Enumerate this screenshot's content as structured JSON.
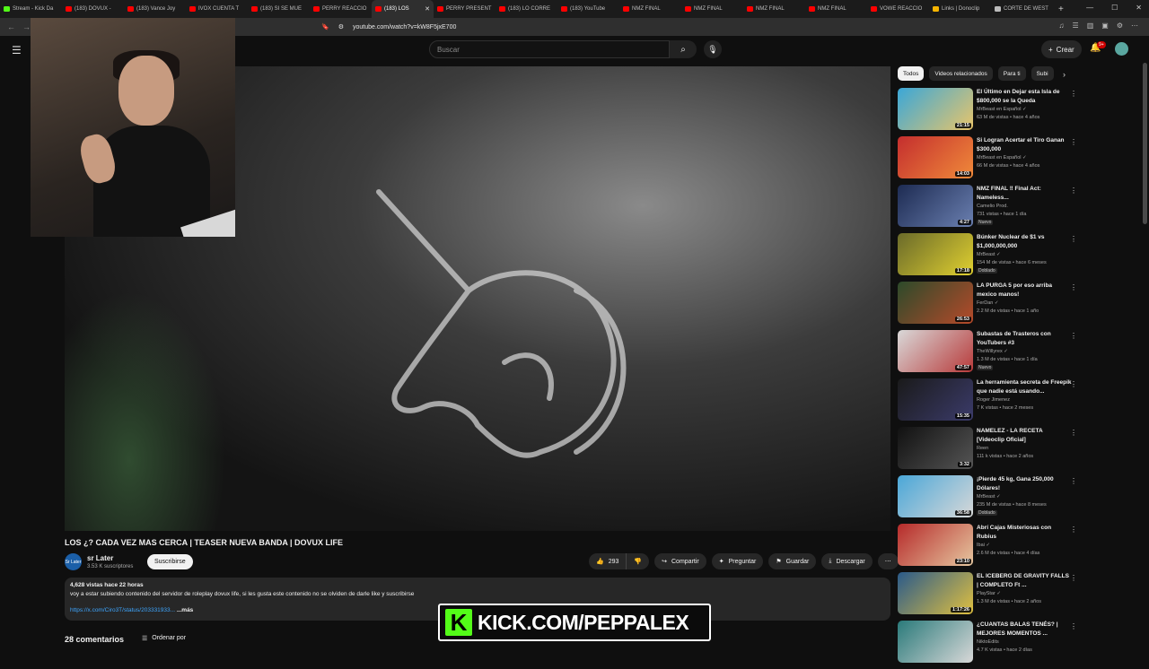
{
  "browser": {
    "tabs": [
      {
        "label": "Stream - Kick Da",
        "color": "#53fc18"
      },
      {
        "label": "(183) DOVUX -",
        "color": "#ff0000"
      },
      {
        "label": "(183) Vance Joy",
        "color": "#ff0000"
      },
      {
        "label": "IVOX CUENTA T",
        "color": "#ff0000"
      },
      {
        "label": "(183) SI SE MUE",
        "color": "#ff0000"
      },
      {
        "label": "PERRY REACCIO",
        "color": "#ff0000"
      },
      {
        "label": "(183) LOS",
        "color": "#ff0000"
      },
      {
        "label": "PERRY PRESENT",
        "color": "#ff0000"
      },
      {
        "label": "(183) LO CORRE",
        "color": "#ff0000"
      },
      {
        "label": "(183) YouTube",
        "color": "#ff0000"
      },
      {
        "label": "NMZ FINAL",
        "color": "#ff0000"
      },
      {
        "label": "NMZ FINAL",
        "color": "#ff0000"
      },
      {
        "label": "NMZ FINAL",
        "color": "#ff0000"
      },
      {
        "label": "NMZ FINAL",
        "color": "#ff0000"
      },
      {
        "label": "VOWE REACCIO",
        "color": "#ff0000"
      },
      {
        "label": "Links | Donoclip",
        "color": "#f5b400"
      },
      {
        "label": "CORTE DE WEST",
        "color": "#bbbbbb"
      }
    ],
    "new_tab": "+",
    "url": "youtube.com/watch?v=kW8F5jxE700"
  },
  "youtube": {
    "search_placeholder": "Buscar",
    "create_label": "Crear",
    "notif_count": "9+",
    "video": {
      "title": "LOS ¿? CADA VEZ MAS CERCA | TEASER NUEVA BANDA | DOVUX LIFE",
      "channel": "sr Later",
      "channel_avatar_text": "Sr Later",
      "subscribers": "3.53 K suscriptores",
      "subscribe_label": "Suscribirse",
      "likes": "293",
      "share_label": "Compartir",
      "ask_label": "Preguntar",
      "save_label": "Guardar",
      "download_label": "Descargar",
      "description_meta": "4,628 vistas  hace 22 horas",
      "description_text": "voy a estar subiendo contenido del servidor de roleplay dovux life, si les gusta este contenido no se olviden de darle like y suscribirse",
      "description_link": "https://x.com/Ciro3T/status/203331933...",
      "more_label": "...más",
      "comments_count": "28 comentarios",
      "sort_label": "Ordenar por"
    },
    "chips": [
      "Todos",
      "Videos relacionados",
      "Para ti",
      "Subi"
    ],
    "recs": [
      {
        "title": "El Último en Dejar esta Isla de $800,000 se la Queda",
        "channel": "MrBeast en Español ✓",
        "meta": "63 M de vistas • hace 4 años",
        "duration": "21:15",
        "badge": "",
        "bg": "linear-gradient(135deg,#3aa7d8,#e8c56a)"
      },
      {
        "title": "Si Logran Acertar el Tiro Ganan $300,000",
        "channel": "MrBeast en Español ✓",
        "meta": "66 M de vistas • hace 4 años",
        "duration": "14:03",
        "badge": "",
        "bg": "linear-gradient(135deg,#c42e2e,#f08a3a)"
      },
      {
        "title": "NMZ FINAL ‼ Final Act: Nameless...",
        "channel": "Camelio Prod.",
        "meta": "731 vistas • hace 1 día",
        "duration": "4:27",
        "badge": "Nuevo",
        "bg": "linear-gradient(135deg,#1d2b52,#6a7fb0)"
      },
      {
        "title": "Búnker Nuclear de $1 vs $1,000,000,000",
        "channel": "MrBeast ✓",
        "meta": "154 M de vistas • hace 6 meses",
        "duration": "17:18",
        "badge": "Doblado",
        "bg": "linear-gradient(135deg,#6a6a2a,#e0d030)"
      },
      {
        "title": "LA PURGA 5 por eso arriba mexico manos!",
        "channel": "FerDan ✓",
        "meta": "2.2 M de vistas • hace 1 año",
        "duration": "26:53",
        "badge": "",
        "bg": "linear-gradient(135deg,#2c4a2a,#b64a2a)"
      },
      {
        "title": "Subastas de Trasteros con YouTubers #3",
        "channel": "TheWillyrex ✓",
        "meta": "1.3 M de vistas • hace 1 día",
        "duration": "47:57",
        "badge": "Nuevo",
        "bg": "linear-gradient(135deg,#d9d9d9,#b83a3a)"
      },
      {
        "title": "La herramienta secreta de Freepik que nadie está usando...",
        "channel": "Roger Jimenez",
        "meta": "7 K vistas • hace 2 meses",
        "duration": "15:35",
        "badge": "",
        "bg": "linear-gradient(135deg,#1a1a1a,#3b3b6a)"
      },
      {
        "title": "NAMELEZ - LA RECETA [Videoclip Oficial]",
        "channel": "Reen",
        "meta": "111 k vistas • hace 2 años",
        "duration": "3:32",
        "badge": "",
        "bg": "linear-gradient(135deg,#111,#555)"
      },
      {
        "title": "¡Pierde 45 kg, Gana 250,000 Dólares!",
        "channel": "MrBeast ✓",
        "meta": "235 M de vistas • hace 8 meses",
        "duration": "36:58",
        "badge": "Doblado",
        "bg": "linear-gradient(135deg,#4aa7d8,#d8d8d8)"
      },
      {
        "title": "Abrí Cajas Misteriosas con Rubius",
        "channel": "Ibai ✓",
        "meta": "2.6 M de vistas • hace 4 días",
        "duration": "23:10",
        "badge": "",
        "bg": "linear-gradient(135deg,#b62a2a,#e6c7a0)"
      },
      {
        "title": "EL ICEBERG DE GRAVITY FALLS | COMPLETO Ft ...",
        "channel": "PlayStar ✓",
        "meta": "1.3 M de vistas • hace 2 años",
        "duration": "1:17:26",
        "badge": "",
        "bg": "linear-gradient(135deg,#2a5a8a,#e0c040)"
      },
      {
        "title": "¿CUANTAS BALAS TENÉS? | MEJORES MOMENTOS ...",
        "channel": "NiktoEdits",
        "meta": "4.7 K vistas • hace 2 días",
        "duration": "",
        "badge": "",
        "bg": "linear-gradient(135deg,#2a7a7a,#d8d8d8)"
      }
    ]
  },
  "overlay": {
    "kick_letter": "K",
    "kick_text": "KICK.COM/PEPPALEX"
  }
}
